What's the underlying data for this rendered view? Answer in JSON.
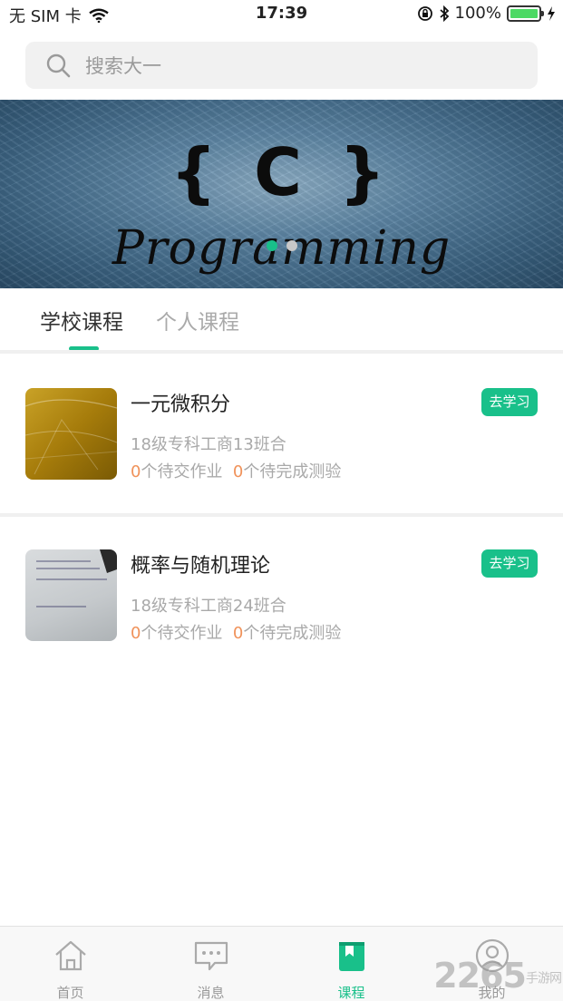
{
  "status_bar": {
    "carrier": "无 SIM 卡",
    "time": "17:39",
    "battery": "100%"
  },
  "search": {
    "placeholder": "搜索大一"
  },
  "banner": {
    "logo_text": "{ C }",
    "script_text": "Programming",
    "dots": [
      true,
      false
    ]
  },
  "tabs": [
    {
      "label": "学校课程",
      "active": true
    },
    {
      "label": "个人课程",
      "active": false
    }
  ],
  "courses": [
    {
      "title": "一元微积分",
      "class": "18级专科工商13班合",
      "pending_homework": "0",
      "homework_label": "个待交作业",
      "pending_tests": "0",
      "tests_label": "个待完成测验",
      "button": "去学习"
    },
    {
      "title": "概率与随机理论",
      "class": "18级专科工商24班合",
      "pending_homework": "0",
      "homework_label": "个待交作业",
      "pending_tests": "0",
      "tests_label": "个待完成测验",
      "button": "去学习"
    }
  ],
  "bottom_nav": [
    {
      "label": "首页",
      "icon": "home-icon",
      "active": false
    },
    {
      "label": "消息",
      "icon": "message-icon",
      "active": false
    },
    {
      "label": "课程",
      "icon": "course-icon",
      "active": true
    },
    {
      "label": "我的",
      "icon": "profile-icon",
      "active": false
    }
  ],
  "watermark": {
    "text": "2265",
    "suffix": "手游网"
  },
  "colors": {
    "accent": "#19c08a",
    "count": "#f0925a"
  }
}
